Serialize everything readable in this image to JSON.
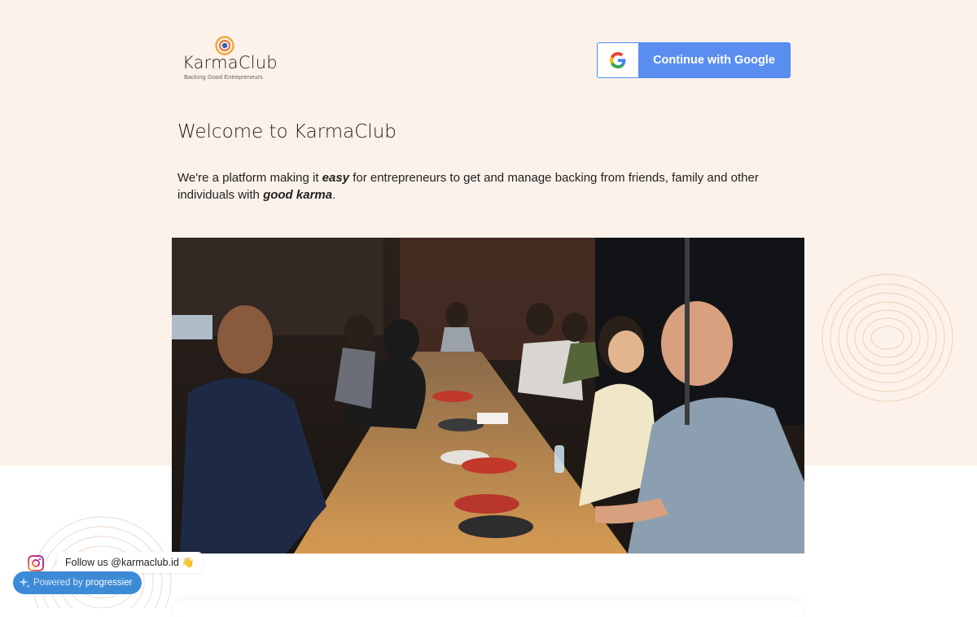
{
  "brand": {
    "name": "KarmaClub",
    "tagline": "Backing Good Entrepreneurs"
  },
  "auth": {
    "google_button_label": "Continue with Google"
  },
  "hero": {
    "title": "Welcome to KarmaClub",
    "intro_1": "We're a platform making it ",
    "intro_emph_1": "easy",
    "intro_2": " for entrepreneurs to get and manage backing from friends, family and other individuals with ",
    "intro_emph_2": "good karma",
    "intro_3": "."
  },
  "social": {
    "follow_prefix": "Follow us ",
    "handle": "@karmaclub.id",
    "emoji": "👋"
  },
  "badge": {
    "prefix": "Powered by ",
    "name": "progressier"
  },
  "icons": {
    "logo": "karma-circle-icon",
    "google": "google-g-icon",
    "instagram": "instagram-icon",
    "sparkle": "sparkle-icon"
  },
  "colors": {
    "hero_bg": "#fcf2ea",
    "google_blue": "#5a8df0",
    "badge_blue": "#3d8bd6"
  }
}
